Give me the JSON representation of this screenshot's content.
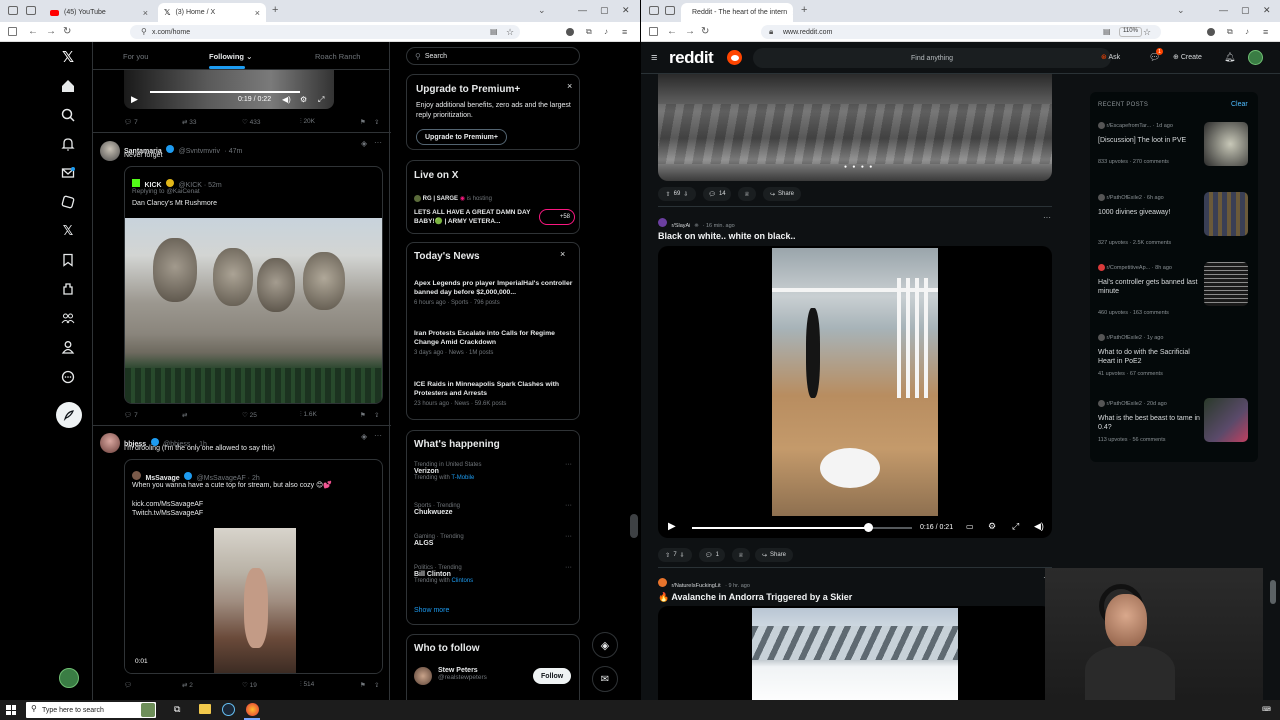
{
  "left_browser": {
    "tabs": [
      {
        "title": "(45) YouTube"
      },
      {
        "title": "(3) Home / X"
      }
    ],
    "url": "x.com/home"
  },
  "x": {
    "tabs": [
      "For you",
      "Following",
      "Roach Ranch"
    ],
    "video1": {
      "time": "0:19 / 0:22"
    },
    "post1_actions": {
      "replies": "7",
      "reposts": "33",
      "likes": "433",
      "views": "20K"
    },
    "post2": {
      "name": "Santamaria",
      "handle": "@Svntvmvriv",
      "time": "· 47m",
      "text": "Never forget",
      "quote": {
        "name": "KICK",
        "handle": "@KICK · 52m",
        "reply": "Replying to @KaiCenat",
        "text": "Dan Clancy's Mt Rushmore"
      },
      "actions": {
        "replies": "7",
        "reposts": "",
        "likes": "25",
        "views": "1.6K"
      }
    },
    "post3": {
      "name": "bbjess",
      "handle": "@bbjess",
      "time": "· 1h",
      "text": "I'm drooling (I'm the only one allowed to say this)",
      "quote": {
        "name": "MsSavage",
        "handle": "@MsSavageAF · 2h",
        "text": "When you wanna have a cute top for stream, but also cozy 😊💕",
        "link1": "kick.com/MsSavageAF",
        "link2": "Twitch.tv/MsSavageAF",
        "video_time": "0:01"
      },
      "actions": {
        "replies": "",
        "reposts": "2",
        "likes": "19",
        "views": "514"
      }
    },
    "search_placeholder": "Search",
    "premium": {
      "title": "Upgrade to Premium+",
      "desc": "Enjoy additional benefits, zero ads and the largest reply prioritization.",
      "button": "Upgrade to Premium+"
    },
    "live": {
      "title": "Live on X",
      "host": "RG | SARGE",
      "hosting": "is hosting",
      "text": "LETS ALL HAVE A GREAT DAMN DAY BABY!🟢 | ARMY VETERA...",
      "count": "+58"
    },
    "news": {
      "title": "Today's News",
      "items": [
        {
          "headline": "Apex Legends pro player ImperialHal's controller banned day before $2,000,000...",
          "meta": "6 hours ago · Sports · 796 posts"
        },
        {
          "headline": "Iran Protests Escalate into Calls for Regime Change Amid Crackdown",
          "meta": "3 days ago · News · 1M posts"
        },
        {
          "headline": "ICE Raids in Minneapolis Spark Clashes with Protesters and Arrests",
          "meta": "23 hours ago · News · 59.6K posts"
        }
      ]
    },
    "happening": {
      "title": "What's happening",
      "items": [
        {
          "context": "Trending in United States",
          "name": "Verizon",
          "extra": "Trending with",
          "extra_link": "T-Mobile"
        },
        {
          "context": "Sports · Trending",
          "name": "Chukwueze",
          "extra": "",
          "extra_link": ""
        },
        {
          "context": "Gaming · Trending",
          "name": "ALGS",
          "extra": "",
          "extra_link": ""
        },
        {
          "context": "Politics · Trending",
          "name": "Bill Clinton",
          "extra": "Trending with",
          "extra_link": "Clintons"
        }
      ],
      "show_more": "Show more"
    },
    "who": {
      "title": "Who to follow",
      "name": "Stew Peters",
      "handle": "@realstewpeters",
      "button": "Follow"
    }
  },
  "right_browser": {
    "tab": "Reddit - The heart of the intern",
    "url": "www.reddit.com",
    "zoom": "110%"
  },
  "reddit": {
    "logo": "reddit",
    "search": "Find anything",
    "ask": "Ask",
    "create": "Create",
    "notif_count": "1",
    "post0_actions": {
      "votes": "69",
      "comments": "14",
      "share": "Share"
    },
    "post1": {
      "sub": "r/SlayAi",
      "time": "· 16 min. ago",
      "title": "Black on white.. white on black..",
      "video_time": "0:16 / 0:21",
      "progress": 0.8,
      "votes": "7",
      "comments": "1",
      "share": "Share"
    },
    "post2": {
      "sub": "r/NatureIsFuckingLit",
      "time": "· 9 hr. ago",
      "title": "🔥 Avalanche in Andorra Triggered by a Skier"
    },
    "recent": {
      "title": "RECENT POSTS",
      "clear": "Clear",
      "items": [
        {
          "sub": "r/EscapefromTar...",
          "time": "· 1d ago",
          "title": "[Discussion] The loot in PVE",
          "upvotes": "833 upvotes",
          "comments": "270 comments"
        },
        {
          "sub": "r/PathOfExile2",
          "time": "· 6h ago",
          "title": "1000 divines giveaway!",
          "upvotes": "327 upvotes",
          "comments": "2.5K comments"
        },
        {
          "sub": "r/CompetitiveAp...",
          "time": "· 8h ago",
          "title": "Hal's controller gets banned last minute",
          "upvotes": "460 upvotes",
          "comments": "163 comments"
        },
        {
          "sub": "r/PathOfExile2",
          "time": "· 1y ago",
          "title": "What to do with the Sacrificial Heart in PoE2",
          "upvotes": "41 upvotes",
          "comments": "67 comments"
        },
        {
          "sub": "r/PathOfExile2",
          "time": "· 20d ago",
          "title": "What is the best beast to tame in 0.4?",
          "upvotes": "113 upvotes",
          "comments": "56 comments"
        }
      ]
    }
  },
  "taskbar": {
    "search": "Type here to search"
  }
}
